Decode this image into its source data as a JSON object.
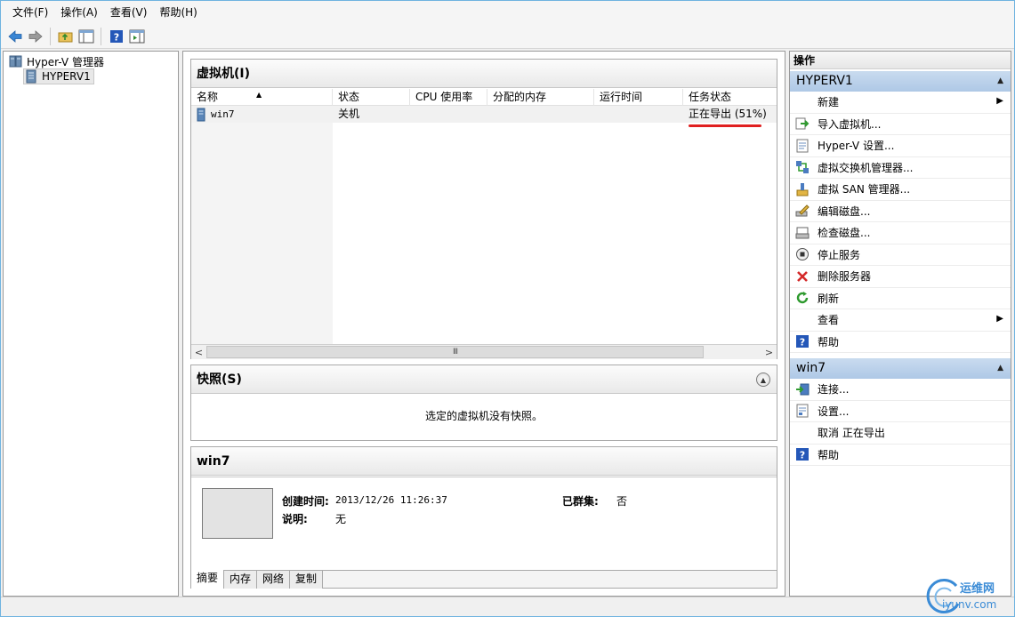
{
  "menu": [
    "文件(F)",
    "操作(A)",
    "查看(V)",
    "帮助(H)"
  ],
  "toolbar": {
    "icons": [
      "back-arrow-icon",
      "forward-arrow-icon",
      "folder-up-icon",
      "console-tree-icon",
      "help-icon",
      "action-pane-icon"
    ]
  },
  "tree": {
    "root": "Hyper-V 管理器",
    "child": "HYPERV1"
  },
  "vm_panel": {
    "title": "虚拟机(I)",
    "columns": [
      "名称",
      "状态",
      "CPU 使用率",
      "分配的内存",
      "运行时间",
      "任务状态"
    ],
    "rows": [
      {
        "name": "win7",
        "state": "关机",
        "cpu": "",
        "memory": "",
        "uptime": "",
        "task": "正在导出 (51%)"
      }
    ],
    "scroll_thumb": "III"
  },
  "snapshot_panel": {
    "title": "快照(S)",
    "empty_text": "选定的虚拟机没有快照。"
  },
  "detail_panel": {
    "title": "win7",
    "created_label": "创建时间:",
    "created_value": "2013/12/26 11:26:37",
    "clustered_label": "已群集:",
    "clustered_value": "否",
    "notes_label": "说明:",
    "notes_value": "无",
    "tabs": [
      "摘要",
      "内存",
      "网络",
      "复制"
    ]
  },
  "actions": {
    "title": "操作",
    "sections": [
      {
        "header": "HYPERV1",
        "items": [
          {
            "label": "新建",
            "icon": "",
            "submenu": true
          },
          {
            "label": "导入虚拟机...",
            "icon": "import-vm-icon"
          },
          {
            "label": "Hyper-V 设置...",
            "icon": "settings-icon"
          },
          {
            "label": "虚拟交换机管理器...",
            "icon": "virtual-switch-icon"
          },
          {
            "label": "虚拟 SAN 管理器...",
            "icon": "san-manager-icon"
          },
          {
            "label": "编辑磁盘...",
            "icon": "edit-disk-icon"
          },
          {
            "label": "检查磁盘...",
            "icon": "inspect-disk-icon"
          },
          {
            "label": "停止服务",
            "icon": "stop-service-icon"
          },
          {
            "label": "删除服务器",
            "icon": "remove-server-icon"
          },
          {
            "label": "刷新",
            "icon": "refresh-icon"
          },
          {
            "label": "查看",
            "icon": "",
            "submenu": true
          },
          {
            "label": "帮助",
            "icon": "help-icon"
          }
        ]
      },
      {
        "header": "win7",
        "items": [
          {
            "label": "连接...",
            "icon": "connect-icon"
          },
          {
            "label": "设置...",
            "icon": "vm-settings-icon"
          },
          {
            "label": "取消 正在导出",
            "icon": ""
          },
          {
            "label": "帮助",
            "icon": "help-icon"
          }
        ]
      }
    ]
  },
  "watermark": {
    "cn": "运维网",
    "en": "iyunv.com"
  },
  "colors": {
    "section_header": "#aec8e6",
    "task_underline": "#e02020",
    "window_border": "#6fb3e0"
  }
}
